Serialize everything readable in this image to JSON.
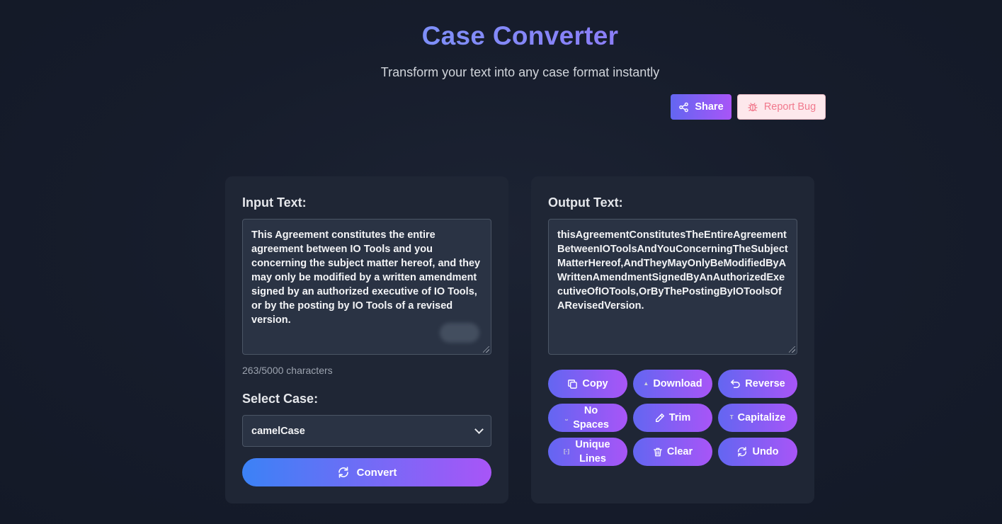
{
  "header": {
    "title": "Case Converter",
    "subtitle": "Transform your text into any case format instantly",
    "share_label": "Share",
    "report_label": "Report Bug"
  },
  "input": {
    "label": "Input Text:",
    "value": "This Agreement constitutes the entire agreement between IO Tools and you concerning the subject matter hereof, and they may only be modified by a written amendment signed by an authorized executive of IO Tools, or by the posting by IO Tools of a revised version.",
    "char_count": "263/5000 characters",
    "select_label": "Select Case:",
    "selected_case": "camelCase",
    "convert_label": "Convert"
  },
  "output": {
    "label": "Output Text:",
    "value": "thisAgreementConstitutesTheEntireAgreementBetweenIOToolsAndYouConcerningTheSubjectMatterHereof,AndTheyMayOnlyBeModifiedByAWrittenAmendmentSignedByAnAuthorizedExecutiveOfIOTools,OrByThePostingByIOToolsOfARevisedVersion.",
    "actions": {
      "copy": "Copy",
      "download": "Download",
      "reverse": "Reverse",
      "no_spaces": "No Spaces",
      "trim": "Trim",
      "capitalize": "Capitalize",
      "unique_lines": "Unique Lines",
      "clear": "Clear",
      "undo": "Undo"
    }
  },
  "colors": {
    "accent_start": "#6366f1",
    "accent_end": "#a855f7",
    "report_text": "#f1798d",
    "background": "#141b2b"
  }
}
